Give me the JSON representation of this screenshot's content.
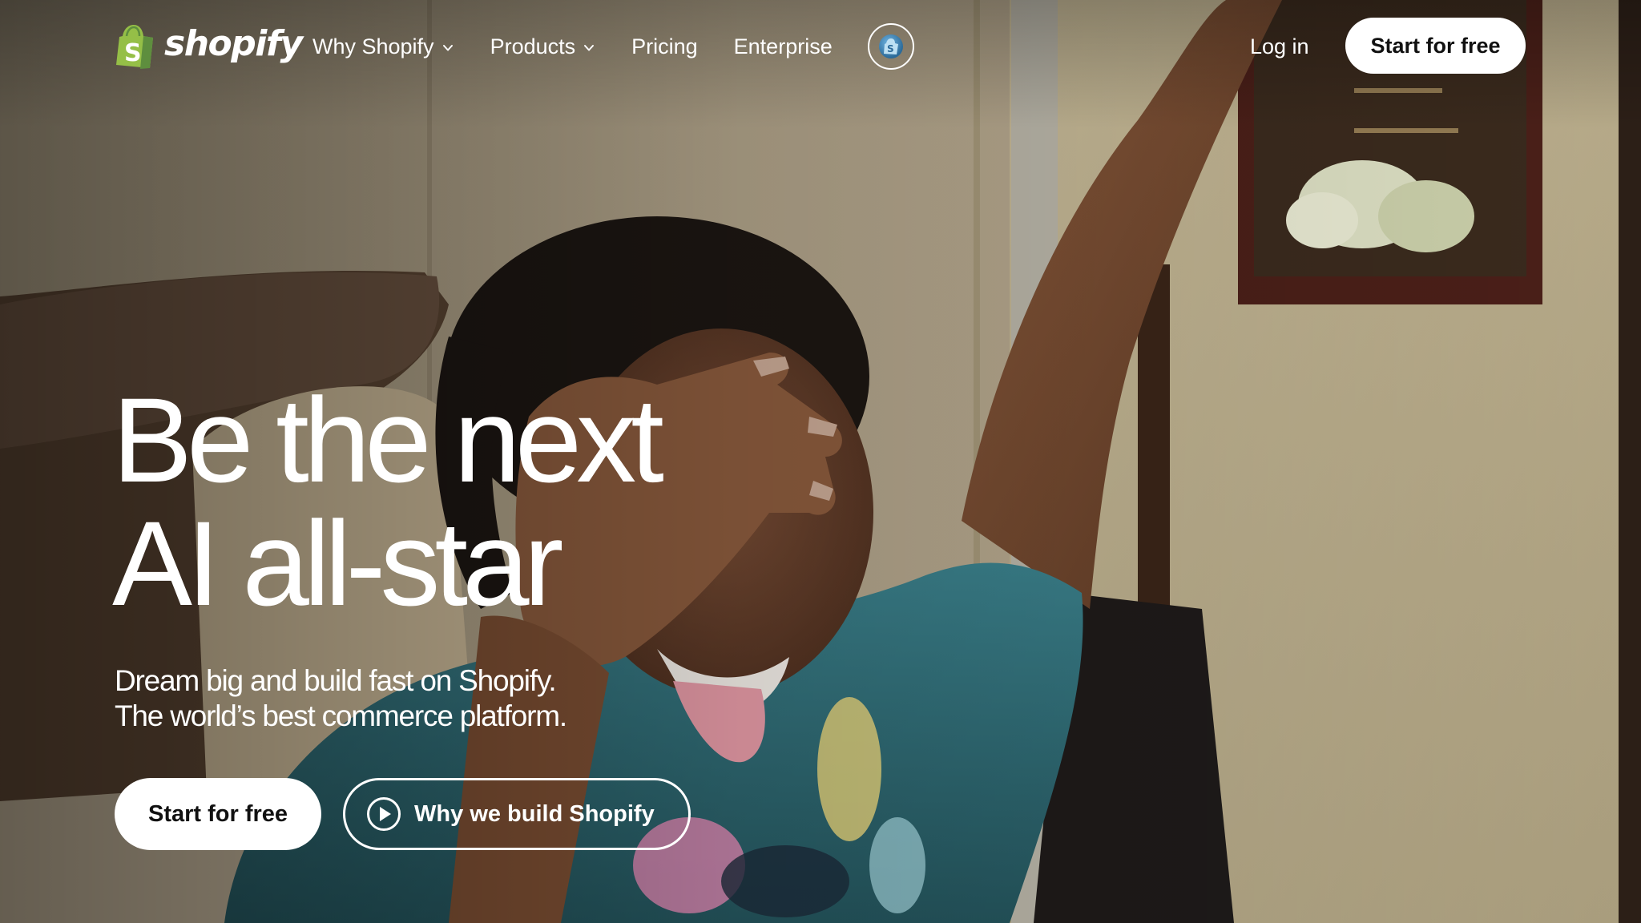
{
  "brand": {
    "logo_text": "shopify",
    "logo_letter": "S",
    "logo_icon": "shopify-bag-icon",
    "accent_green": "#95bf47",
    "dark_green": "#5e8e3e"
  },
  "nav": {
    "items": [
      {
        "label": "Why Shopify",
        "has_dropdown": true,
        "icon": "chevron-down-icon"
      },
      {
        "label": "Products",
        "has_dropdown": true,
        "icon": "chevron-down-icon"
      },
      {
        "label": "Pricing",
        "has_dropdown": false
      },
      {
        "label": "Enterprise",
        "has_dropdown": false
      }
    ],
    "circle_icon": "shopify-app-icon",
    "login_label": "Log in",
    "cta_label": "Start for free"
  },
  "hero": {
    "title_line1": "Be the next",
    "title_line2": "AI all-star",
    "subtitle_line1": "Dream big and build fast on Shopify.",
    "subtitle_line2": "The world’s best commerce platform.",
    "primary_cta": "Start for free",
    "secondary_cta": "Why we build Shopify",
    "secondary_icon": "play-circle-icon"
  },
  "background": {
    "description_icon": "hero-video-frame",
    "wall_color": "#b4a68c",
    "shirt_color": "#2f6a74",
    "frame_color": "#4a1f18"
  }
}
